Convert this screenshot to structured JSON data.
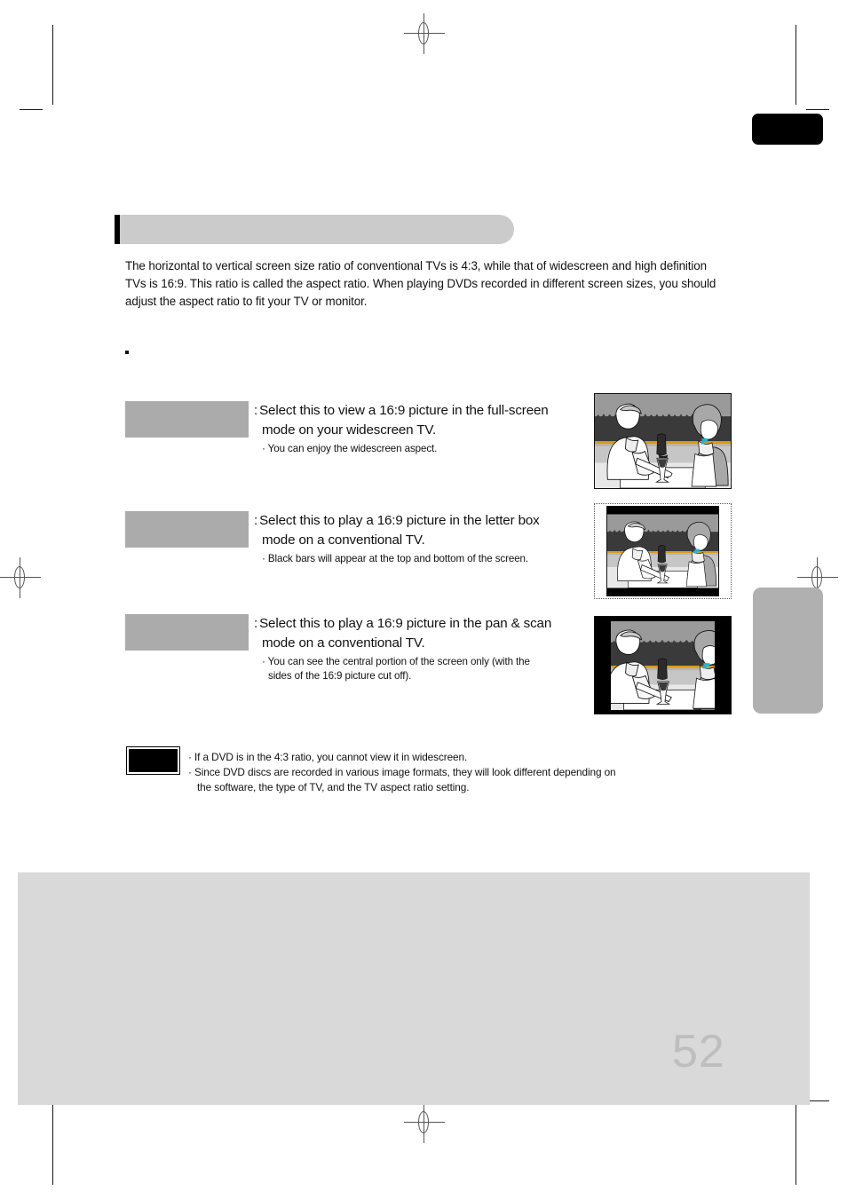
{
  "document": {
    "page_number": "52",
    "section_title": "",
    "intro_paragraph": "The horizontal to vertical screen size ratio of conventional TVs is 4:3, while that of widescreen and high definition TVs is 16:9. This ratio is called the aspect ratio. When playing DVDs recorded in different screen sizes, you should adjust the aspect ratio to fit your TV or monitor.",
    "lead_bullet": ""
  },
  "options": [
    {
      "label": "",
      "colon": ":",
      "description_line1": "Select this to view a 16:9 picture in the full-screen",
      "description_line2": "mode on your widescreen TV.",
      "sub_bullet": "· You can enjoy the widescreen aspect.",
      "sub_bullet_cont": "",
      "illustration": "widescreen-16-9-full"
    },
    {
      "label": "",
      "colon": ":",
      "description_line1": "Select this to play a 16:9 picture in the letter box",
      "description_line2": "mode on a conventional TV.",
      "sub_bullet": "· Black bars will appear at the top and bottom of the screen.",
      "sub_bullet_cont": "",
      "illustration": "letterbox-4-3"
    },
    {
      "label": "",
      "colon": ":",
      "description_line1": "Select this to play a 16:9 picture in the pan & scan",
      "description_line2": "mode on a conventional TV.",
      "sub_bullet": "· You can see the central portion of the screen only (with the",
      "sub_bullet_cont": "sides of the 16:9 picture cut off).",
      "illustration": "pan-and-scan-4-3"
    }
  ],
  "note": {
    "icon_label": "",
    "line1": "· If a DVD is in the 4:3 ratio, you cannot view it in widescreen.",
    "line2": "· Since DVD discs are recorded in various image formats, they will look different depending on",
    "line2_cont": "the software, the type of TV, and the TV aspect ratio setting."
  },
  "colors": {
    "header_bar": "#cbcbcb",
    "header_accent": "#000000",
    "option_label": "#ababab",
    "footer_block": "#d9d9d9",
    "page_number": "#bebebe",
    "side_tab": "#b0b0b0",
    "corner_tab": "#000000"
  }
}
